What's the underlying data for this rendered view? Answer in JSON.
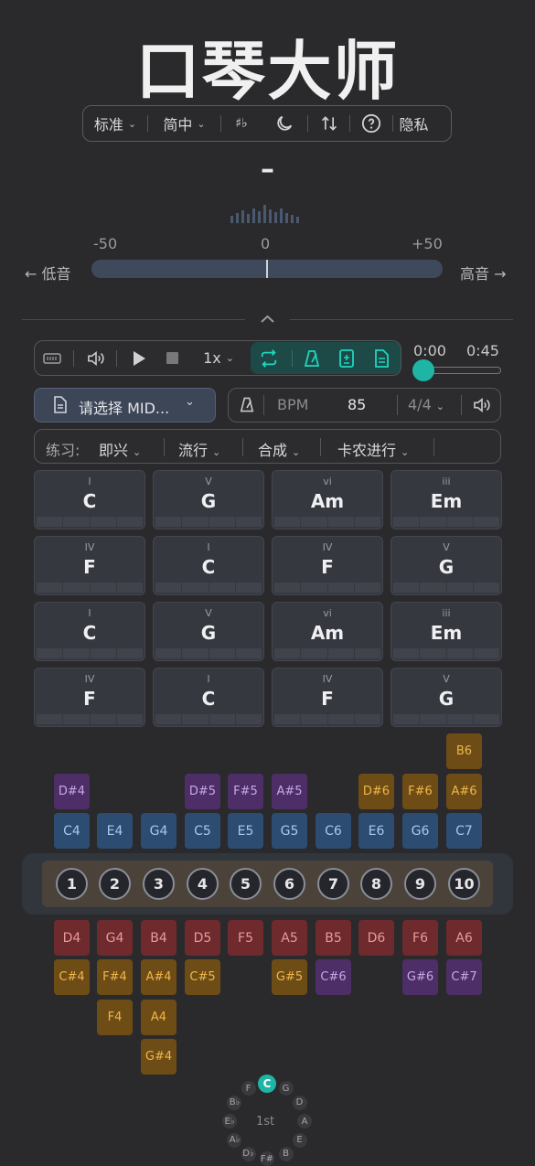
{
  "app": {
    "title": "口琴大师"
  },
  "toolbar": {
    "tuning": "标准",
    "language": "简中",
    "accidental_icon": "sharp-flat-icon",
    "theme_icon": "moon-icon",
    "swap_icon": "swap-vertical-icon",
    "help_icon": "help-circle-icon",
    "privacy": "隐私"
  },
  "tuner": {
    "current_note": "–",
    "scale_min": "-50",
    "scale_mid": "0",
    "scale_max": "+50",
    "low_label": "← 低音",
    "high_label": "高音 →"
  },
  "player": {
    "speed": "1x",
    "time_current": "0:00",
    "time_total": "0:45",
    "progress": 0.0
  },
  "midi": {
    "select_label": "请选择 MID..."
  },
  "metronome": {
    "bpm_label": "BPM",
    "bpm_value": "85",
    "time_signature": "4/4"
  },
  "practice": {
    "label": "练习:",
    "options": [
      "即兴",
      "流行",
      "合成",
      "卡农进行"
    ]
  },
  "chords": [
    {
      "roman": "I",
      "name": "C"
    },
    {
      "roman": "V",
      "name": "G"
    },
    {
      "roman": "vi",
      "name": "Am"
    },
    {
      "roman": "iii",
      "name": "Em"
    },
    {
      "roman": "IV",
      "name": "F"
    },
    {
      "roman": "I",
      "name": "C"
    },
    {
      "roman": "IV",
      "name": "F"
    },
    {
      "roman": "V",
      "name": "G"
    },
    {
      "roman": "I",
      "name": "C"
    },
    {
      "roman": "V",
      "name": "G"
    },
    {
      "roman": "vi",
      "name": "Am"
    },
    {
      "roman": "iii",
      "name": "Em"
    },
    {
      "roman": "IV",
      "name": "F"
    },
    {
      "roman": "I",
      "name": "C"
    },
    {
      "roman": "IV",
      "name": "F"
    },
    {
      "roman": "V",
      "name": "G"
    }
  ],
  "blow": {
    "overblow": [
      "",
      "",
      "",
      "",
      "",
      "",
      "",
      "",
      "",
      "B6"
    ],
    "bend": [
      "D#4",
      "",
      "",
      "D#5",
      "F#5",
      "A#5",
      "",
      "D#6",
      "F#6",
      "A#6"
    ],
    "bend_color": [
      "purple",
      "",
      "",
      "purple",
      "purple",
      "purple",
      "",
      "orange",
      "orange",
      "orange"
    ],
    "notes": [
      "C4",
      "E4",
      "G4",
      "C5",
      "E5",
      "G5",
      "C6",
      "E6",
      "G6",
      "C7"
    ]
  },
  "holes": [
    "1",
    "2",
    "3",
    "4",
    "5",
    "6",
    "7",
    "8",
    "9",
    "10"
  ],
  "draw": {
    "notes": [
      "D4",
      "G4",
      "B4",
      "D5",
      "F5",
      "A5",
      "B5",
      "D6",
      "F6",
      "A6"
    ],
    "bend1": [
      "C#4",
      "F#4",
      "A#4",
      "C#5",
      "",
      "G#5",
      "C#6",
      "",
      "G#6",
      "C#7"
    ],
    "bend1_color": [
      "orange",
      "orange",
      "orange",
      "orange",
      "",
      "orange",
      "purple",
      "",
      "purple",
      "purple"
    ],
    "bend2": [
      "",
      "F4",
      "A4",
      "",
      "",
      "",
      "",
      "",
      "",
      ""
    ],
    "bend3": [
      "",
      "",
      "G#4",
      "",
      "",
      "",
      "",
      "",
      "",
      ""
    ]
  },
  "circle_of_fifths": {
    "center": "1st",
    "selected": "C",
    "keys": [
      "C",
      "G",
      "D",
      "A",
      "E",
      "B",
      "F#",
      "D♭",
      "A♭",
      "E♭",
      "B♭",
      "F"
    ]
  },
  "colors": {
    "accent": "#1fb5a4",
    "blow": "#2c4c72",
    "draw": "#6e2a2c",
    "bend_orange": "#6e4c16",
    "bend_purple": "#4e2e66"
  }
}
